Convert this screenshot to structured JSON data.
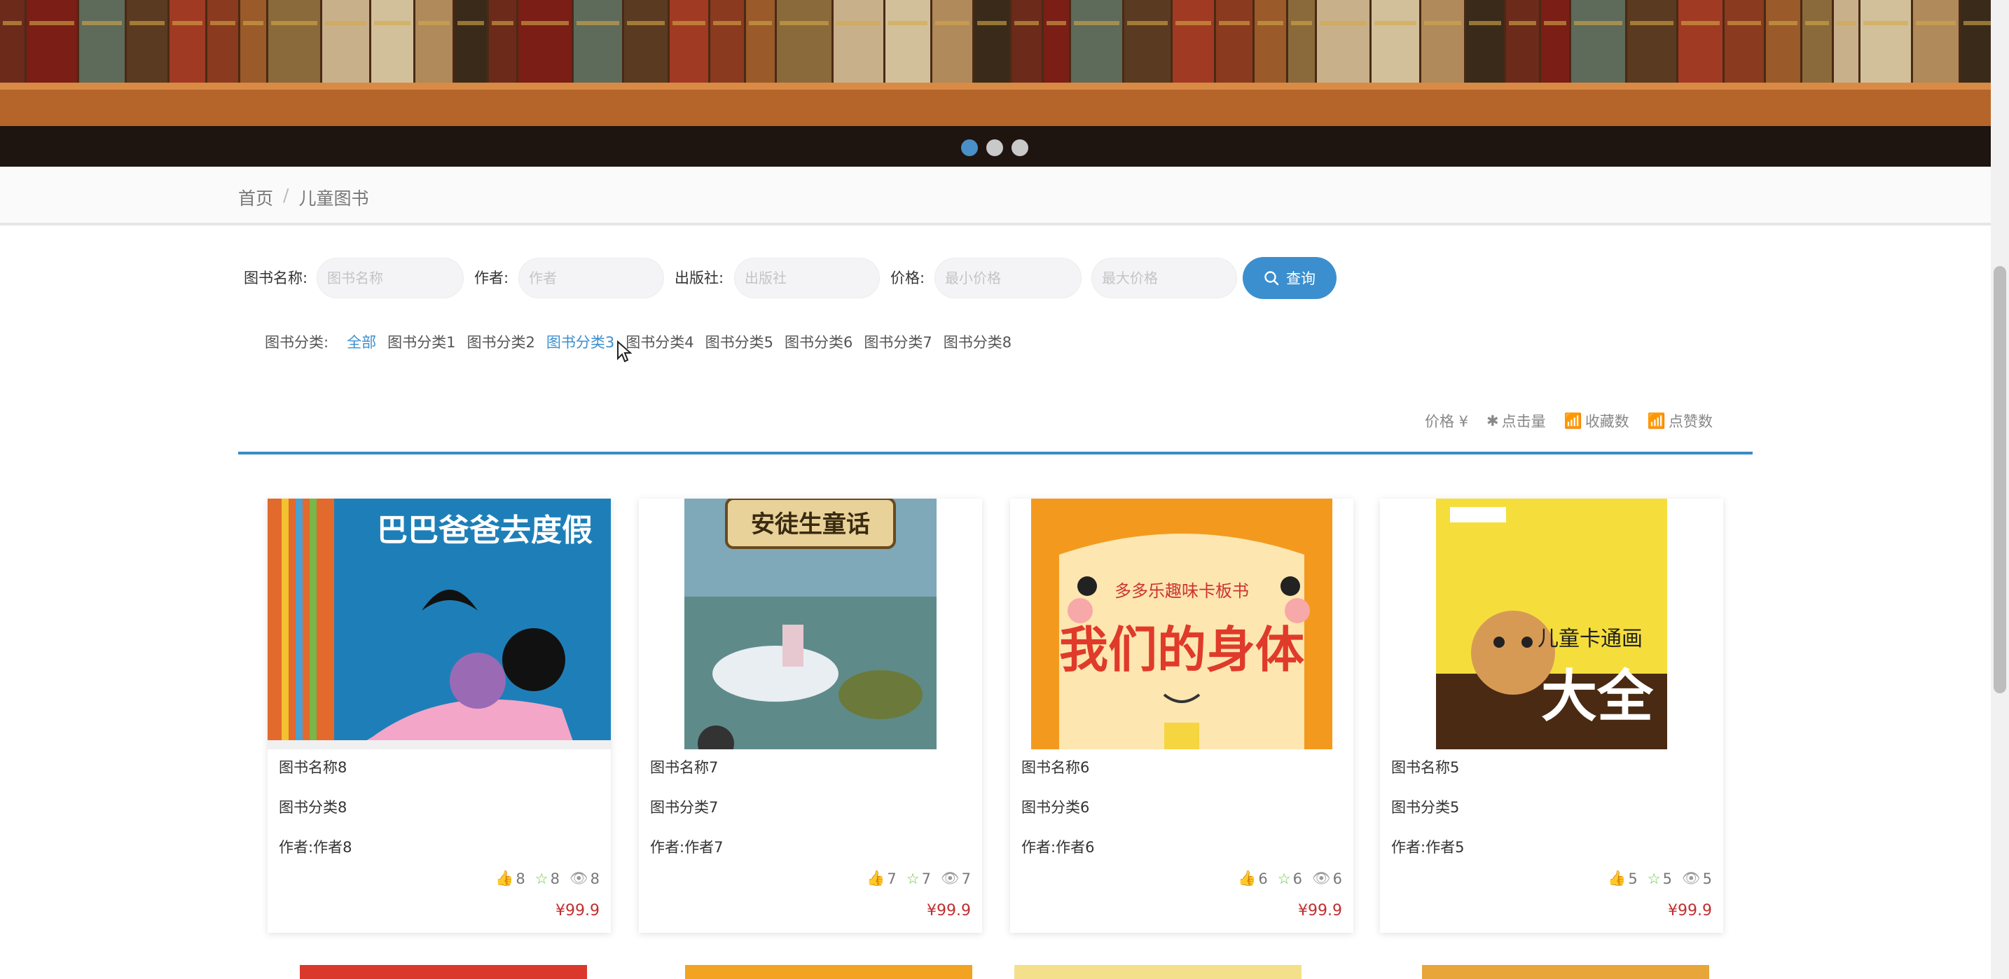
{
  "breadcrumb": {
    "home": "首页",
    "separator": "/",
    "current": "儿童图书"
  },
  "search": {
    "name_label": "图书名称:",
    "name_placeholder": "图书名称",
    "author_label": "作者:",
    "author_placeholder": "作者",
    "publisher_label": "出版社:",
    "publisher_placeholder": "出版社",
    "price_label": "价格:",
    "min_placeholder": "最小价格",
    "max_placeholder": "最大价格",
    "query_label": "查询"
  },
  "categories": {
    "label": "图书分类:",
    "items": [
      "全部",
      "图书分类1",
      "图书分类2",
      "图书分类3",
      "图书分类4",
      "图书分类5",
      "图书分类6",
      "图书分类7",
      "图书分类8"
    ]
  },
  "sort": {
    "price": "价格 ¥",
    "clicks": "点击量",
    "favorites": "收藏数",
    "likes": "点赞数"
  },
  "colors": {
    "accent": "#3b8fcf",
    "price": "#c03030"
  },
  "books": [
    {
      "name": "图书名称8",
      "category": "图书分类8",
      "author": "作者:作者8",
      "likes": "8",
      "favorites": "8",
      "views": "8",
      "price": "¥99.9",
      "cover_title": "巴巴爸爸去度假"
    },
    {
      "name": "图书名称7",
      "category": "图书分类7",
      "author": "作者:作者7",
      "likes": "7",
      "favorites": "7",
      "views": "7",
      "price": "¥99.9",
      "cover_title": "安徒生童话"
    },
    {
      "name": "图书名称6",
      "category": "图书分类6",
      "author": "作者:作者6",
      "likes": "6",
      "favorites": "6",
      "views": "6",
      "price": "¥99.9",
      "cover_title": "我们的身体",
      "cover_subtitle": "多多乐趣味卡板书"
    },
    {
      "name": "图书名称5",
      "category": "图书分类5",
      "author": "作者:作者5",
      "likes": "5",
      "favorites": "5",
      "views": "5",
      "price": "¥99.9",
      "cover_title": "大全",
      "cover_subtitle": "儿童卡通画"
    }
  ]
}
